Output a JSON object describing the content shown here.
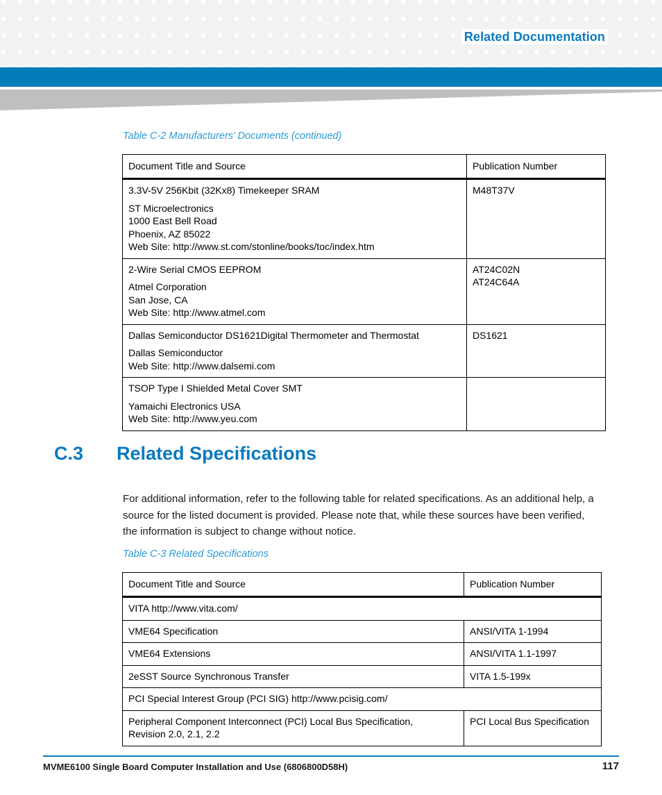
{
  "header": {
    "title": "Related Documentation",
    "accent_blue": "#057cba",
    "title_blue": "#0b7abf",
    "square_color": "#f3f3f3",
    "wedge_color": "#bfbfbf"
  },
  "table_c2": {
    "caption": "Table C-2 Manufacturers’ Documents (continued)",
    "columns": [
      "Document Title and Source",
      "Publication Number"
    ],
    "rows": [
      {
        "title": "3.3V-5V 256Kbit (32Kx8) Timekeeper SRAM",
        "source": "ST Microelectronics\n1000 East Bell Road\nPhoenix, AZ 85022\nWeb Site: http://www.st.com/stonline/books/toc/index.htm",
        "publication": "M48T37V"
      },
      {
        "title": "2-Wire Serial CMOS EEPROM",
        "source": "Atmel Corporation\nSan Jose, CA\nWeb Site: http://www.atmel.com",
        "publication": "AT24C02N\nAT24C64A"
      },
      {
        "title": "Dallas Semiconductor DS1621Digital Thermometer and Thermostat",
        "source": "Dallas Semiconductor\nWeb Site: http://www.dalsemi.com",
        "publication": "DS1621"
      },
      {
        "title": "TSOP Type I Shielded Metal Cover SMT",
        "source": "Yamaichi Electronics USA\nWeb Site: http://www.yeu.com",
        "publication": ""
      }
    ]
  },
  "section": {
    "number": "C.3",
    "title": "Related Specifications",
    "paragraph": "For additional information, refer to the following table for related specifications. As an additional help, a source for the listed document is provided. Please note that, while these sources have been verified, the information is subject to change without notice."
  },
  "table_c3": {
    "caption": "Table C-3 Related Specifications",
    "columns": [
      "Document Title and Source",
      "Publication Number"
    ],
    "rows": [
      {
        "title": "VITA http://www.vita.com/",
        "publication": "",
        "span": true
      },
      {
        "title": "VME64 Specification",
        "publication": "ANSI/VITA 1-1994",
        "span": false
      },
      {
        "title": "VME64 Extensions",
        "publication": "ANSI/VITA 1.1-1997",
        "span": false
      },
      {
        "title": "2eSST Source Synchronous Transfer",
        "publication": "VITA 1.5-199x",
        "span": false
      },
      {
        "title": "PCI Special Interest Group (PCI SIG) http://www.pcisig.com/",
        "publication": "",
        "span": true
      },
      {
        "title": "Peripheral Component Interconnect (PCI) Local Bus Specification,\nRevision 2.0, 2.1, 2.2",
        "publication": "PCI Local Bus Specification",
        "span": false
      }
    ]
  },
  "footer": {
    "document": "MVME6100 Single Board Computer Installation and Use (6806800D58H)",
    "page_number": "117"
  }
}
